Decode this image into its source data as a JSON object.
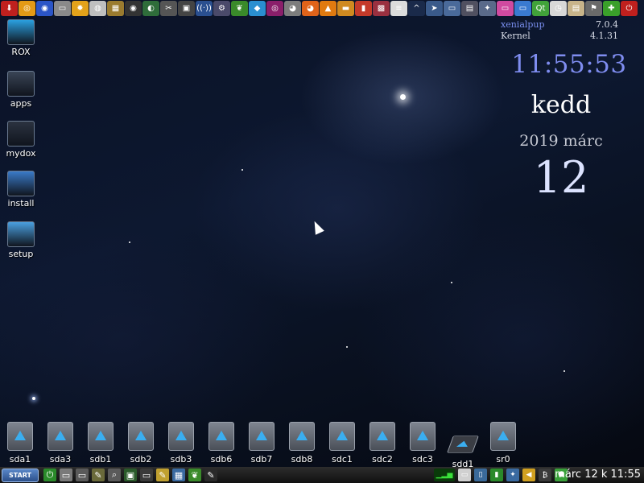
{
  "top_launcher": {
    "icons": [
      {
        "name": "down-arrow-icon",
        "glyph": "⬇",
        "color": "#c0201e"
      },
      {
        "name": "puppy-icon",
        "glyph": "◎",
        "color": "#e49a16"
      },
      {
        "name": "globe-icon",
        "glyph": "◉",
        "color": "#2b55c7"
      },
      {
        "name": "drive-icon",
        "glyph": "▭",
        "color": "#8a8a8a"
      },
      {
        "name": "sun-icon",
        "glyph": "✹",
        "color": "#e3a21a"
      },
      {
        "name": "disc-icon",
        "glyph": "◍",
        "color": "#bfbfbf"
      },
      {
        "name": "grid-icon",
        "glyph": "▦",
        "color": "#9a7b2f"
      },
      {
        "name": "media-icon",
        "glyph": "◉",
        "color": "#333333"
      },
      {
        "name": "world-icon",
        "glyph": "◐",
        "color": "#2f6d3a"
      },
      {
        "name": "tools-icon",
        "glyph": "✂",
        "color": "#555555"
      },
      {
        "name": "image-icon",
        "glyph": "▣",
        "color": "#444444"
      },
      {
        "name": "wifi-icon",
        "glyph": "((·))",
        "color": "#2a4f8f"
      },
      {
        "name": "settings-icon",
        "glyph": "⚙",
        "color": "#4a4a6a"
      },
      {
        "name": "leaf-icon",
        "glyph": "❦",
        "color": "#3a8a2a"
      },
      {
        "name": "kite-icon",
        "glyph": "◆",
        "color": "#2a8fd0"
      },
      {
        "name": "target-icon",
        "glyph": "◎",
        "color": "#8a1f6a"
      },
      {
        "name": "sphere-icon",
        "glyph": "◕",
        "color": "#7d7d7d"
      },
      {
        "name": "firefox-icon",
        "glyph": "◕",
        "color": "#e0631a"
      },
      {
        "name": "vlc-icon",
        "glyph": "▲",
        "color": "#e07a10"
      },
      {
        "name": "hat-icon",
        "glyph": "▬",
        "color": "#d08a20"
      },
      {
        "name": "pencils-icon",
        "glyph": "▮",
        "color": "#c43a2a"
      },
      {
        "name": "picture-icon",
        "glyph": "▩",
        "color": "#9a3040"
      },
      {
        "name": "text-icon",
        "glyph": "≡",
        "color": "#dcdcdc"
      },
      {
        "name": "chevron-up-icon",
        "glyph": "^",
        "color": "#1a2a4a"
      },
      {
        "name": "pointer-icon",
        "glyph": "➤",
        "color": "#3a5a8a"
      },
      {
        "name": "monitor-icon",
        "glyph": "▭",
        "color": "#4a6a9a"
      },
      {
        "name": "floppy-icon",
        "glyph": "▤",
        "color": "#505060"
      },
      {
        "name": "puzzle-icon",
        "glyph": "✦",
        "color": "#5a6a8a"
      },
      {
        "name": "screenshot-icon",
        "glyph": "▭",
        "color": "#d04aa0"
      },
      {
        "name": "window-icon",
        "glyph": "▭",
        "color": "#3a7ad0"
      },
      {
        "name": "qt-icon",
        "glyph": "Qt",
        "color": "#41a33a"
      },
      {
        "name": "clock-icon",
        "glyph": "◷",
        "color": "#d8d8d8"
      },
      {
        "name": "notes-icon",
        "glyph": "▤",
        "color": "#c8b48a"
      },
      {
        "name": "flag-icon",
        "glyph": "⚑",
        "color": "#6a6a6a"
      },
      {
        "name": "puzzle-piece-icon",
        "glyph": "✚",
        "color": "#3aa02a"
      },
      {
        "name": "power-icon",
        "glyph": "⏻",
        "color": "#c0201e"
      }
    ]
  },
  "desktop": {
    "items": [
      {
        "label": "ROX",
        "icon": "rox-monitor-icon",
        "color": "#2aa0e0"
      },
      {
        "label": "apps",
        "icon": "apps-folder-icon",
        "color": "#3a4556"
      },
      {
        "label": "mydox",
        "icon": "mydox-folder-icon",
        "color": "#2b3340"
      },
      {
        "label": "install",
        "icon": "install-icon",
        "color": "#3a7ac8"
      },
      {
        "label": "setup",
        "icon": "setup-icon",
        "color": "#4aa0e0"
      }
    ]
  },
  "widget": {
    "os_key": "xenialpup",
    "os_val": "7.0.4",
    "kernel_key": "Kernel",
    "kernel_val": "4.1.31",
    "time": "11:55:53",
    "day": "kedd",
    "year_month": "2019 márc",
    "date": "12"
  },
  "drives": [
    {
      "label": "sda1"
    },
    {
      "label": "sda3"
    },
    {
      "label": "sdb1"
    },
    {
      "label": "sdb2"
    },
    {
      "label": "sdb3"
    },
    {
      "label": "sdb6"
    },
    {
      "label": "sdb7"
    },
    {
      "label": "sdb8"
    },
    {
      "label": "sdc1"
    },
    {
      "label": "sdc2"
    },
    {
      "label": "sdc3"
    },
    {
      "label": "sdd1"
    },
    {
      "label": "sr0"
    }
  ],
  "taskbar": {
    "start_label": "START",
    "clock": "márc 12 k 11:55",
    "left_icons": [
      {
        "name": "power-icon",
        "glyph": "⏻",
        "color": "#2a8a2a"
      },
      {
        "name": "drive-icon",
        "glyph": "▭",
        "color": "#7a7a7a"
      },
      {
        "name": "drive2-icon",
        "glyph": "▭",
        "color": "#5a5a5a"
      },
      {
        "name": "tools-icon",
        "glyph": "✎",
        "color": "#6a6a3a"
      },
      {
        "name": "magnifier-icon",
        "glyph": "⌕",
        "color": "#5a5a5a"
      },
      {
        "name": "terminal-icon",
        "glyph": "▣",
        "color": "#2a5a2a"
      },
      {
        "name": "monitor-icon",
        "glyph": "▭",
        "color": "#3a3a3a"
      },
      {
        "name": "edit-icon",
        "glyph": "✎",
        "color": "#c0a030"
      },
      {
        "name": "calculator-icon",
        "glyph": "▦",
        "color": "#3a6aa0"
      },
      {
        "name": "leaf-icon",
        "glyph": "❦",
        "color": "#3a8a2a"
      },
      {
        "name": "pen-icon",
        "glyph": "✎",
        "color": "#2a2a2a"
      }
    ],
    "tray_icons": [
      {
        "name": "cpu-graph-icon",
        "glyph": "▁▂▅",
        "color": "#0a3a0a"
      },
      {
        "name": "clipboard-icon",
        "glyph": "▭",
        "color": "#d0d0d0"
      },
      {
        "name": "mobile-icon",
        "glyph": "▯",
        "color": "#3a6a9a"
      },
      {
        "name": "battery-icon",
        "glyph": "▮",
        "color": "#2a8a2a"
      },
      {
        "name": "network-icon",
        "glyph": "✦",
        "color": "#3a6aa0"
      },
      {
        "name": "volume-icon",
        "glyph": "◀",
        "color": "#d0a020"
      },
      {
        "name": "thermo-icon",
        "glyph": "₿",
        "color": "#3a3a3a"
      },
      {
        "name": "shield-icon",
        "glyph": "⬟",
        "color": "#3aa03a"
      }
    ]
  }
}
